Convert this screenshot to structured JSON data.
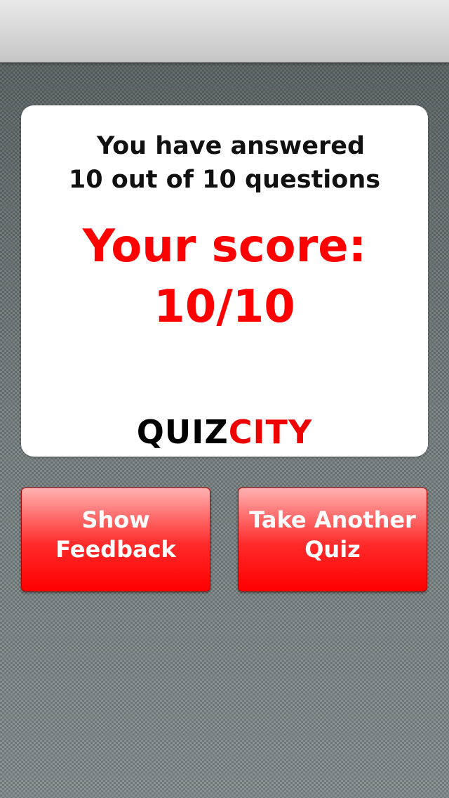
{
  "result": {
    "answered_line1": "You have answered",
    "answered_line2": "10 out of 10 questions",
    "score_label": "Your score:",
    "score_value": "10/10"
  },
  "logo": {
    "part1": "QUIZ",
    "part2": "CITY"
  },
  "buttons": {
    "show_feedback_line1": "Show",
    "show_feedback_line2": "Feedback",
    "take_another_line1": "Take Another",
    "take_another_line2": "Quiz"
  },
  "colors": {
    "accent_red": "#ff0000",
    "text_dark": "#111111",
    "card_bg": "#ffffff"
  }
}
